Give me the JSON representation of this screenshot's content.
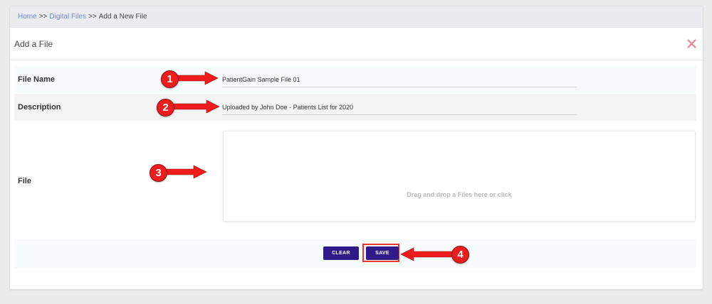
{
  "breadcrumb": {
    "items": [
      {
        "label": "Home",
        "link": true
      },
      {
        "label": "Digital Files",
        "link": true
      },
      {
        "label": "Add a New File",
        "link": false
      }
    ],
    "separator": ">>"
  },
  "header": {
    "title": "Add a File",
    "close_icon": "close-icon"
  },
  "form": {
    "file_name": {
      "label": "File Name",
      "value": "PatientGain Sample File 01"
    },
    "description": {
      "label": "Description",
      "value": "Uploaded by John Doe - Patients List for 2020"
    },
    "file": {
      "label": "File",
      "dropzone_text": "Drag and drop a Files here or click"
    }
  },
  "actions": {
    "clear_label": "CLEAR",
    "save_label": "SAVE"
  },
  "annotations": {
    "badges": [
      "1",
      "2",
      "3",
      "4"
    ]
  },
  "colors": {
    "primary_button": "#2e1a88",
    "annotation_red": "#ee1c1c",
    "link": "#6f86d6",
    "close_icon": "#e8858d"
  }
}
